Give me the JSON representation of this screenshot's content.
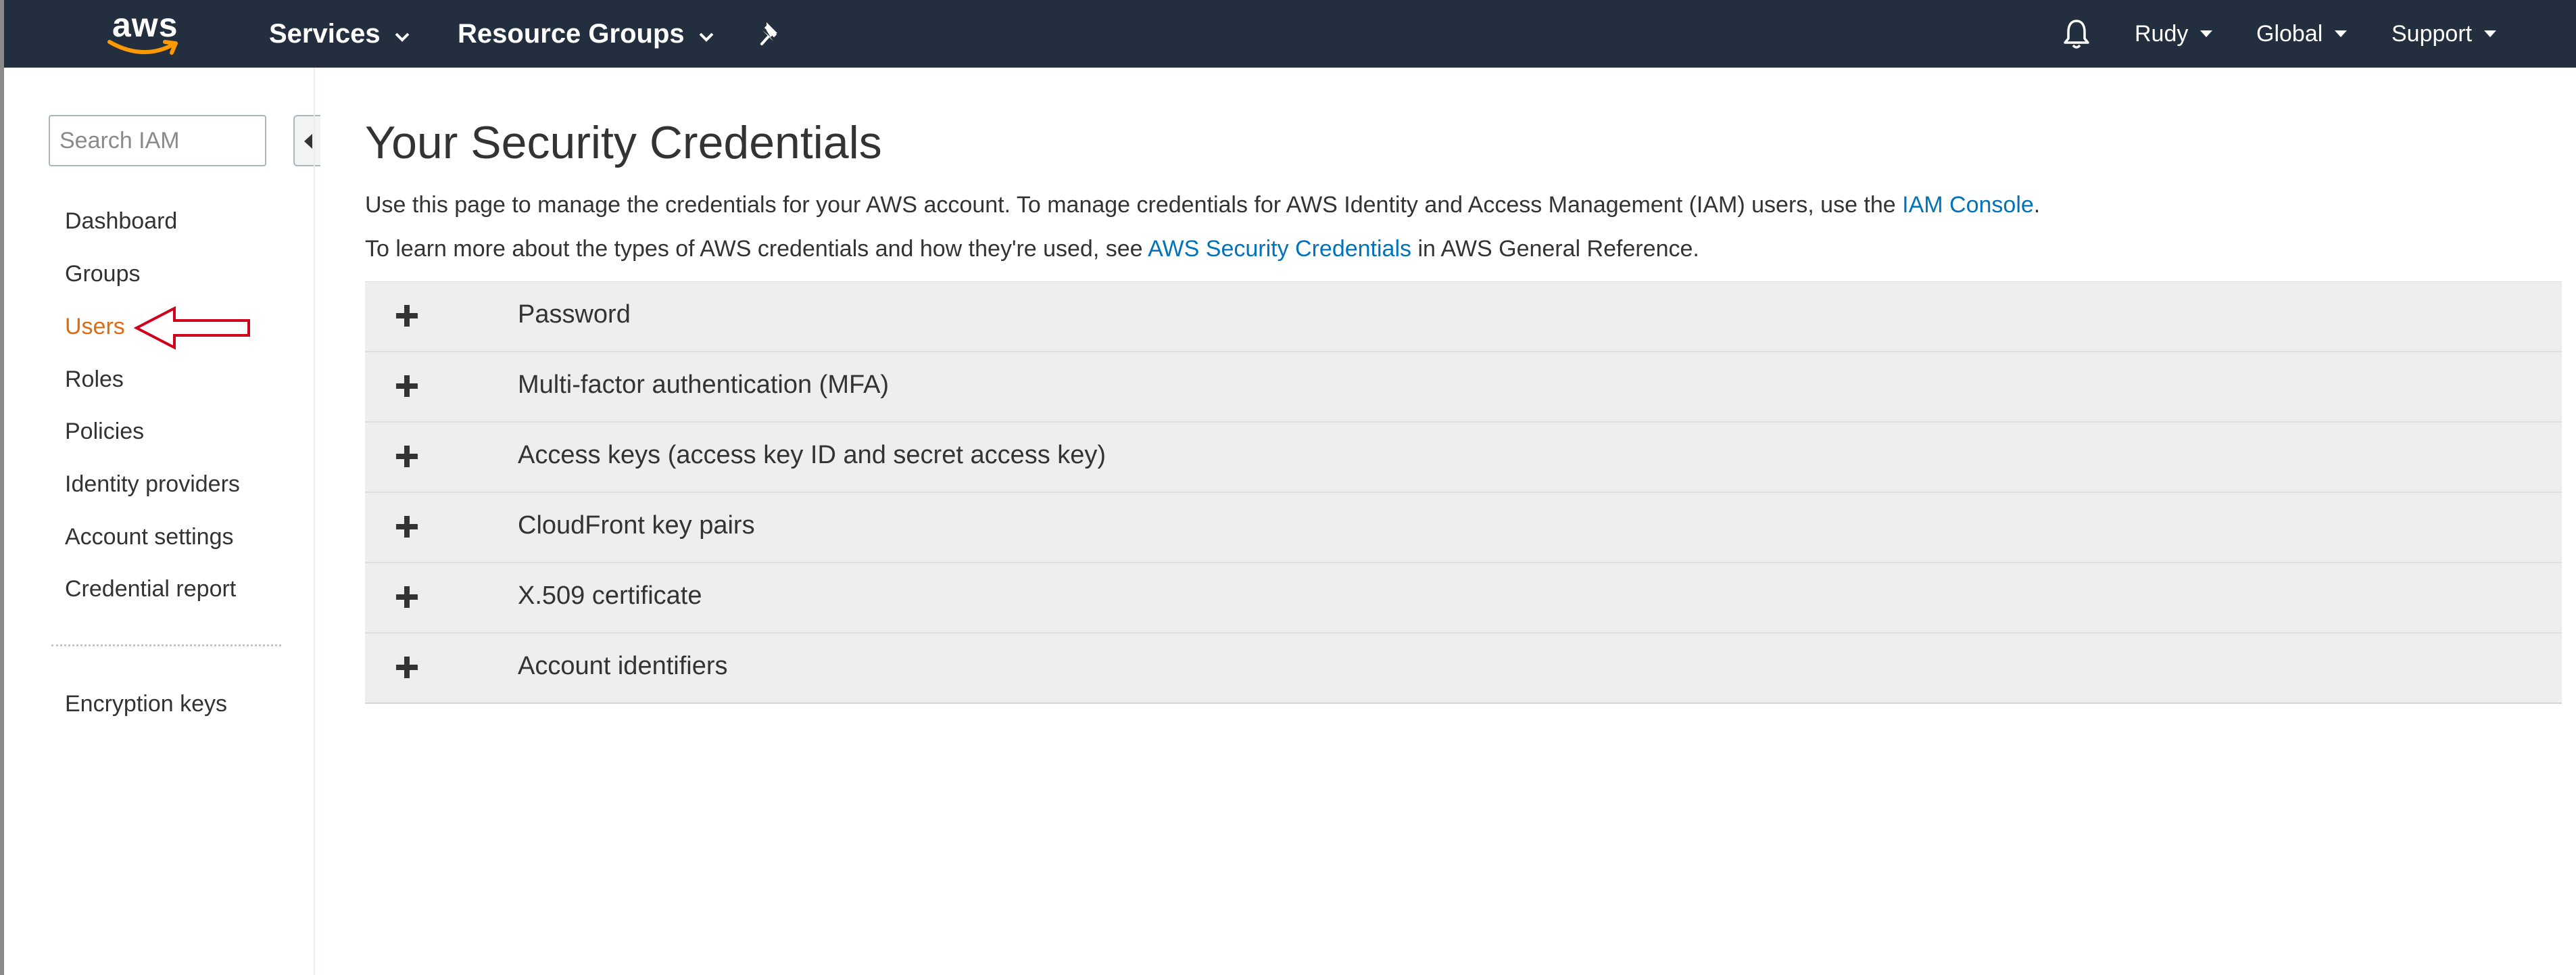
{
  "topbar": {
    "logo": "aws",
    "services_label": "Services",
    "resource_groups_label": "Resource Groups",
    "pin_icon": "pushpin-icon",
    "bell_icon": "bell-icon",
    "user_label": "Rudy",
    "region_label": "Global",
    "support_label": "Support",
    "colors": {
      "background": "#232f3e",
      "logo_smile": "#ff9900"
    }
  },
  "sidebar": {
    "search_placeholder": "Search IAM",
    "items": [
      {
        "label": "Dashboard"
      },
      {
        "label": "Groups"
      },
      {
        "label": "Users",
        "active": true
      },
      {
        "label": "Roles"
      },
      {
        "label": "Policies"
      },
      {
        "label": "Identity providers"
      },
      {
        "label": "Account settings"
      },
      {
        "label": "Credential report"
      }
    ],
    "extra_items": [
      {
        "label": "Encryption keys"
      }
    ],
    "active_color": "#dd6b10"
  },
  "annotation": {
    "arrow_color": "#d0021b",
    "points_to": "Users"
  },
  "main": {
    "title": "Your Security Credentials",
    "desc1_text": "Use this page to manage the credentials for your AWS account. To manage credentials for AWS Identity and Access Management (IAM) users, use the",
    "desc1_link": "IAM Console",
    "desc1_end": ".",
    "desc2_text": "To learn more about the types of AWS credentials and how they're used, see",
    "desc2_link": "AWS Security Credentials",
    "desc2_end": "in AWS General Reference.",
    "sections": [
      {
        "label": "Password"
      },
      {
        "label": "Multi-factor authentication (MFA)"
      },
      {
        "label": "Access keys (access key ID and secret access key)"
      },
      {
        "label": "CloudFront key pairs"
      },
      {
        "label": "X.509 certificate"
      },
      {
        "label": "Account identifiers"
      }
    ],
    "link_color": "#0073bb"
  }
}
